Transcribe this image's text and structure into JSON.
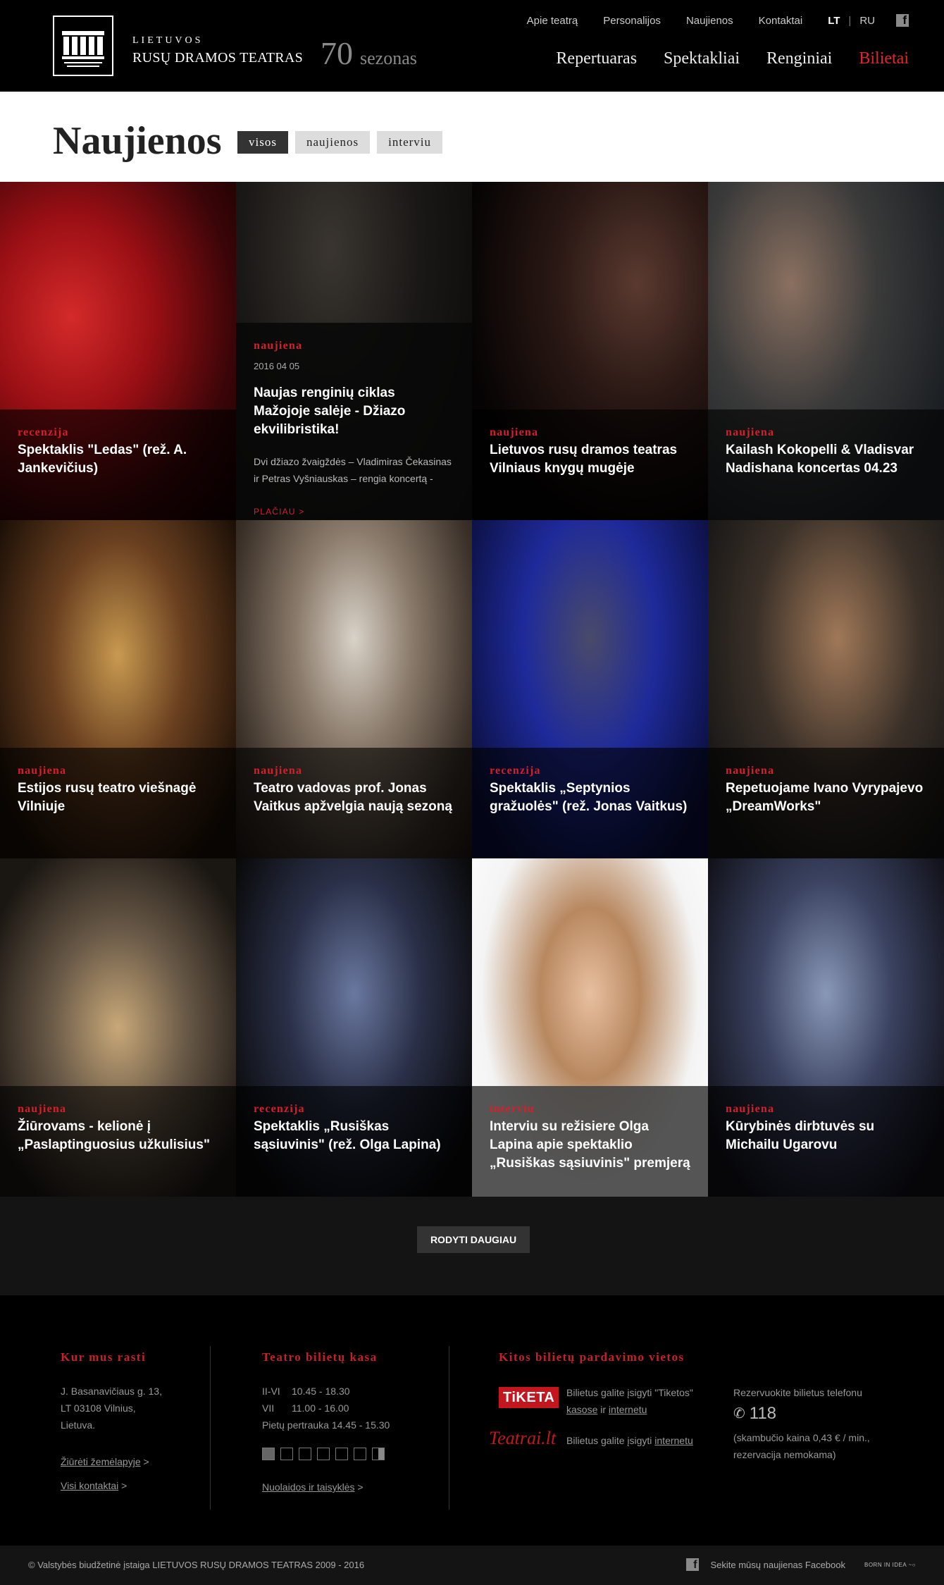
{
  "header": {
    "logo_alt": "LIETUVOS RUSŲ DRAMOS TEATRAS",
    "brand_line1": "LIETUVOS",
    "brand_line2": "RUSŲ DRAMOS TEATRAS",
    "season_number": "70",
    "season_word": "sezonas",
    "top_links": [
      "Apie teatrą",
      "Personalijos",
      "Naujienos",
      "Kontaktai"
    ],
    "lang_lt": "LT",
    "lang_sep": "|",
    "lang_ru": "RU",
    "facebook_icon": "facebook-icon",
    "main_nav": [
      "Repertuaras",
      "Spektakliai",
      "Renginiai",
      "Bilietai"
    ],
    "accent_color": "#e4262d"
  },
  "page": {
    "title": "Naujienos",
    "filters": [
      "visos",
      "naujienos",
      "interviu"
    ],
    "active_filter": "visos"
  },
  "tiles": [
    {
      "category": "recenzija",
      "title": "Spektaklis \"Ledas\" (rež. A. Jankevičius)"
    },
    {
      "category": "naujiena",
      "date": "2016 04 05",
      "title": "Naujas renginių ciklas Mažojoje salėje - Džiazo ekvilibristika!",
      "description": "Dvi džiazo žvaigždės – Vladimiras Čekasinas ir Petras Vyšniauskas – rengia koncertą -",
      "more": "PLAČIAU >"
    },
    {
      "category": "naujiena",
      "title": "Lietuvos rusų dramos teatras Vilniaus knygų mugėje"
    },
    {
      "category": "naujiena",
      "title": "Kailash Kokopelli & Vladisvar Nadishana koncertas 04.23"
    },
    {
      "category": "naujiena",
      "title": "Estijos rusų teatro viešnagė Vilniuje"
    },
    {
      "category": "naujiena",
      "title": "Teatro vadovas prof. Jonas Vaitkus apžvelgia naują sezoną"
    },
    {
      "category": "recenzija",
      "title": "Spektaklis „Septynios gražuolės\" (rež. Jonas Vaitkus)"
    },
    {
      "category": "naujiena",
      "title": "Repetuojame Ivano Vyrypajevo „DreamWorks\""
    },
    {
      "category": "naujiena",
      "title": "Žiūrovams - kelionė į „Paslaptinguosius užkulisius\""
    },
    {
      "category": "recenzija",
      "title": "Spektaklis „Rusiškas sąsiuvinis\" (rež. Olga Lapina)"
    },
    {
      "category": "interviu",
      "title": "Interviu su režisiere Olga Lapina apie spektaklio „Rusiškas sąsiuvinis\" premjerą"
    },
    {
      "category": "naujiena",
      "title": "Kūrybinės dirbtuvės su Michailu Ugarovu"
    }
  ],
  "show_more": "RODYTI DAUGIAU",
  "footer": {
    "where": {
      "heading": "Kur mus rasti",
      "address": [
        "J. Basanavičiaus g. 13,",
        "LT 03108 Vilnius,",
        "Lietuva."
      ],
      "map_link": "Žiūrėti žemėlapyje",
      "contacts_link": "Visi kontaktai",
      "arrow": ">"
    },
    "box_office": {
      "heading": "Teatro bilietų kasa",
      "hours": [
        {
          "days": "II-VI",
          "time": "10.45 - 18.30"
        },
        {
          "days": "VII",
          "time": "11.00 - 16.00"
        }
      ],
      "lunch": "Pietų pertrauka  14.45 - 15.30",
      "discounts_link": "Nuolaidos ir taisyklės",
      "arrow": ">"
    },
    "other": {
      "heading": "Kitos bilietų pardavimo vietos",
      "tiketa_logo": "TiKETA",
      "tiketa_text": "Bilietus galite įsigyti \"Tiketos\"",
      "tiketa_kasose": "kasose",
      "tiketa_ir": "ir",
      "tiketa_internetu": "internetu",
      "teatrai_logo": "Teatrai.lt",
      "teatrai_text": "Bilietus galite įsigyti",
      "teatrai_internetu": "internetu",
      "reserve_text": "Rezervuokite bilietus telefonu",
      "phone_icon": "phone-icon",
      "phone": "118",
      "phone_note": "(skambučio kaina 0,43 € / min., rezervacija nemokama)"
    }
  },
  "bottom": {
    "copyright": "© Valstybės biudžetinė įstaiga LIETUVOS RUSŲ DRAMOS TEATRAS 2009 - 2016",
    "facebook_follow": "Sekite mūsų naujienas Facebook",
    "credit": "BORN IN IDEA ~○"
  }
}
